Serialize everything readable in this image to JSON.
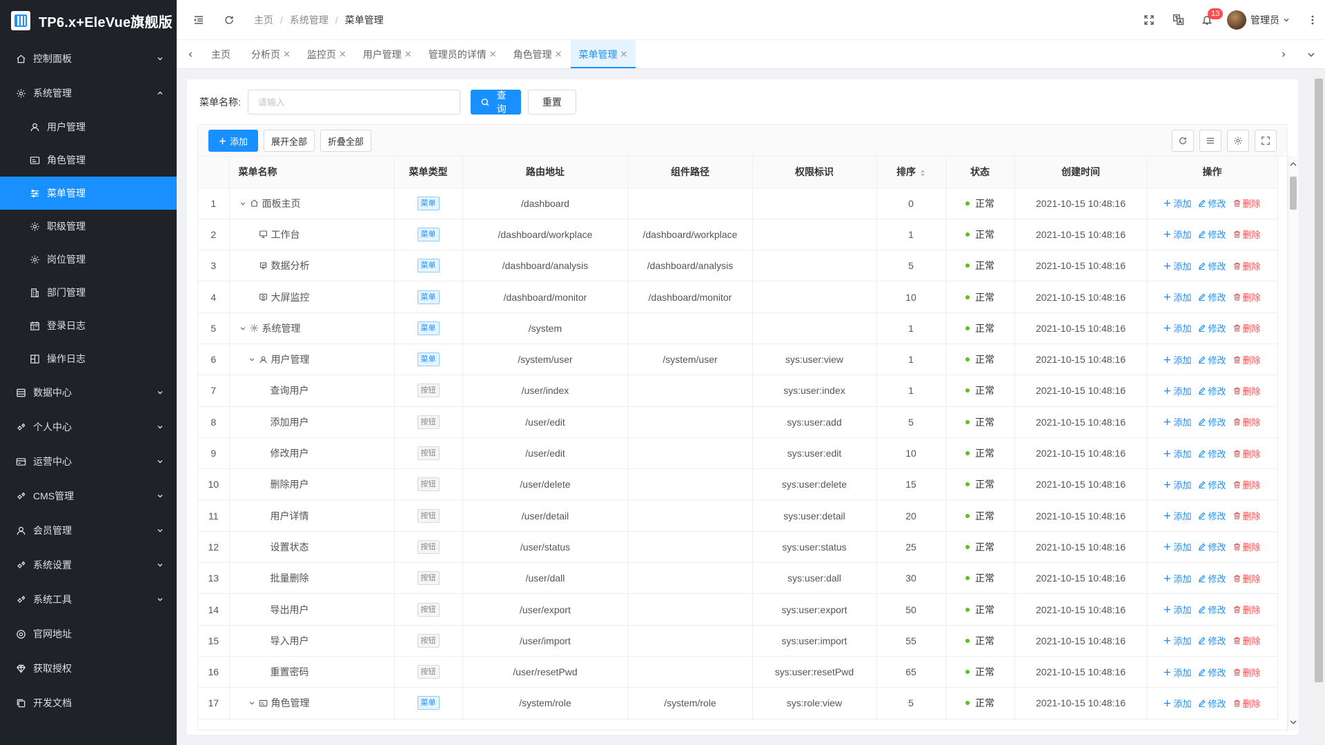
{
  "app": {
    "title": "TP6.x+EleVue旗舰版"
  },
  "sidebar": {
    "items": [
      {
        "label": "控制面板",
        "icon": "home-icon",
        "level": "top",
        "expandable": true,
        "expanded": false,
        "active": false
      },
      {
        "label": "系统管理",
        "icon": "gear-icon",
        "level": "top",
        "expandable": true,
        "expanded": true,
        "active": false
      },
      {
        "label": "用户管理",
        "icon": "user-icon",
        "level": "sub",
        "active": false
      },
      {
        "label": "角色管理",
        "icon": "id-card-icon",
        "level": "sub",
        "active": false
      },
      {
        "label": "菜单管理",
        "icon": "sliders-icon",
        "level": "sub",
        "active": true
      },
      {
        "label": "职级管理",
        "icon": "gear-icon",
        "level": "sub",
        "active": false
      },
      {
        "label": "岗位管理",
        "icon": "gear-icon",
        "level": "sub",
        "active": false
      },
      {
        "label": "部门管理",
        "icon": "building-icon",
        "level": "sub",
        "active": false
      },
      {
        "label": "登录日志",
        "icon": "calendar-icon",
        "level": "sub",
        "active": false
      },
      {
        "label": "操作日志",
        "icon": "log-icon",
        "level": "sub",
        "active": false
      },
      {
        "label": "数据中心",
        "icon": "database-icon",
        "level": "top",
        "expandable": true,
        "active": false
      },
      {
        "label": "个人中心",
        "icon": "gears-icon",
        "level": "top",
        "expandable": true,
        "active": false
      },
      {
        "label": "运营中心",
        "icon": "wallet-icon",
        "level": "top",
        "expandable": true,
        "active": false
      },
      {
        "label": "CMS管理",
        "icon": "gears-icon",
        "level": "top",
        "expandable": true,
        "active": false
      },
      {
        "label": "会员管理",
        "icon": "user-icon",
        "level": "top",
        "expandable": true,
        "active": false
      },
      {
        "label": "系统设置",
        "icon": "gears-icon",
        "level": "top",
        "expandable": true,
        "active": false
      },
      {
        "label": "系统工具",
        "icon": "gears-icon",
        "level": "top",
        "expandable": true,
        "active": false
      },
      {
        "label": "官网地址",
        "icon": "globe-icon",
        "level": "top",
        "expandable": false,
        "active": false
      },
      {
        "label": "获取授权",
        "icon": "diamond-icon",
        "level": "top",
        "expandable": false,
        "active": false
      },
      {
        "label": "开发文档",
        "icon": "copy-icon",
        "level": "top",
        "expandable": false,
        "active": false
      }
    ]
  },
  "header": {
    "breadcrumb": [
      "主页",
      "系统管理",
      "菜单管理"
    ],
    "notification_count": "13",
    "user_name": "管理员"
  },
  "tabs": [
    {
      "label": "主页",
      "closable": false,
      "active": false
    },
    {
      "label": "分析页",
      "closable": true,
      "active": false
    },
    {
      "label": "监控页",
      "closable": true,
      "active": false
    },
    {
      "label": "用户管理",
      "closable": true,
      "active": false
    },
    {
      "label": "管理员的详情",
      "closable": true,
      "active": false
    },
    {
      "label": "角色管理",
      "closable": true,
      "active": false
    },
    {
      "label": "菜单管理",
      "closable": true,
      "active": true
    }
  ],
  "search": {
    "label": "菜单名称:",
    "placeholder": "请输入",
    "value": "",
    "query_label": "查询",
    "reset_label": "重置"
  },
  "toolbar": {
    "add_label": "添加",
    "expand_all_label": "展开全部",
    "collapse_all_label": "折叠全部"
  },
  "table": {
    "columns": [
      "",
      "菜单名称",
      "菜单类型",
      "路由地址",
      "组件路径",
      "权限标识",
      "排序",
      "状态",
      "创建时间",
      "操作"
    ],
    "op_labels": {
      "add": "添加",
      "edit": "修改",
      "delete": "删除"
    },
    "rows": [
      {
        "index": "1",
        "name": "面板主页",
        "depth": 0,
        "arrow": true,
        "icon": "home-icon",
        "type": "菜单",
        "type_kind": "menu",
        "path": "/dashboard",
        "component": "",
        "perm": "",
        "sort": "0",
        "status": "正常",
        "created": "2021-10-15 10:48:16"
      },
      {
        "index": "2",
        "name": "工作台",
        "depth": 1,
        "arrow": false,
        "icon": "monitor-icon",
        "type": "菜单",
        "type_kind": "menu",
        "path": "/dashboard/workplace",
        "component": "/dashboard/workplace",
        "perm": "",
        "sort": "1",
        "status": "正常",
        "created": "2021-10-15 10:48:16"
      },
      {
        "index": "3",
        "name": "数据分析",
        "depth": 1,
        "arrow": false,
        "icon": "chart-icon",
        "type": "菜单",
        "type_kind": "menu",
        "path": "/dashboard/analysis",
        "component": "/dashboard/analysis",
        "perm": "",
        "sort": "5",
        "status": "正常",
        "created": "2021-10-15 10:48:16"
      },
      {
        "index": "4",
        "name": "大屏监控",
        "depth": 1,
        "arrow": false,
        "icon": "screen-icon",
        "type": "菜单",
        "type_kind": "menu",
        "path": "/dashboard/monitor",
        "component": "/dashboard/monitor",
        "perm": "",
        "sort": "10",
        "status": "正常",
        "created": "2021-10-15 10:48:16"
      },
      {
        "index": "5",
        "name": "系统管理",
        "depth": 0,
        "arrow": true,
        "icon": "gear-icon",
        "type": "菜单",
        "type_kind": "menu",
        "path": "/system",
        "component": "",
        "perm": "",
        "sort": "1",
        "status": "正常",
        "created": "2021-10-15 10:48:16"
      },
      {
        "index": "6",
        "name": "用户管理",
        "depth": 1,
        "arrow": true,
        "icon": "user-icon",
        "type": "菜单",
        "type_kind": "menu",
        "path": "/system/user",
        "component": "/system/user",
        "perm": "sys:user:view",
        "sort": "1",
        "status": "正常",
        "created": "2021-10-15 10:48:16"
      },
      {
        "index": "7",
        "name": "查询用户",
        "depth": 2,
        "arrow": false,
        "icon": "",
        "type": "按钮",
        "type_kind": "button",
        "path": "/user/index",
        "component": "",
        "perm": "sys:user:index",
        "sort": "1",
        "status": "正常",
        "created": "2021-10-15 10:48:16"
      },
      {
        "index": "8",
        "name": "添加用户",
        "depth": 2,
        "arrow": false,
        "icon": "",
        "type": "按钮",
        "type_kind": "button",
        "path": "/user/edit",
        "component": "",
        "perm": "sys:user:add",
        "sort": "5",
        "status": "正常",
        "created": "2021-10-15 10:48:16"
      },
      {
        "index": "9",
        "name": "修改用户",
        "depth": 2,
        "arrow": false,
        "icon": "",
        "type": "按钮",
        "type_kind": "button",
        "path": "/user/edit",
        "component": "",
        "perm": "sys:user:edit",
        "sort": "10",
        "status": "正常",
        "created": "2021-10-15 10:48:16"
      },
      {
        "index": "10",
        "name": "删除用户",
        "depth": 2,
        "arrow": false,
        "icon": "",
        "type": "按钮",
        "type_kind": "button",
        "path": "/user/delete",
        "component": "",
        "perm": "sys:user:delete",
        "sort": "15",
        "status": "正常",
        "created": "2021-10-15 10:48:16"
      },
      {
        "index": "11",
        "name": "用户详情",
        "depth": 2,
        "arrow": false,
        "icon": "",
        "type": "按钮",
        "type_kind": "button",
        "path": "/user/detail",
        "component": "",
        "perm": "sys:user:detail",
        "sort": "20",
        "status": "正常",
        "created": "2021-10-15 10:48:16"
      },
      {
        "index": "12",
        "name": "设置状态",
        "depth": 2,
        "arrow": false,
        "icon": "",
        "type": "按钮",
        "type_kind": "button",
        "path": "/user/status",
        "component": "",
        "perm": "sys:user:status",
        "sort": "25",
        "status": "正常",
        "created": "2021-10-15 10:48:16"
      },
      {
        "index": "13",
        "name": "批量删除",
        "depth": 2,
        "arrow": false,
        "icon": "",
        "type": "按钮",
        "type_kind": "button",
        "path": "/user/dall",
        "component": "",
        "perm": "sys:user:dall",
        "sort": "30",
        "status": "正常",
        "created": "2021-10-15 10:48:16"
      },
      {
        "index": "14",
        "name": "导出用户",
        "depth": 2,
        "arrow": false,
        "icon": "",
        "type": "按钮",
        "type_kind": "button",
        "path": "/user/export",
        "component": "",
        "perm": "sys:user:export",
        "sort": "50",
        "status": "正常",
        "created": "2021-10-15 10:48:16"
      },
      {
        "index": "15",
        "name": "导入用户",
        "depth": 2,
        "arrow": false,
        "icon": "",
        "type": "按钮",
        "type_kind": "button",
        "path": "/user/import",
        "component": "",
        "perm": "sys:user:import",
        "sort": "55",
        "status": "正常",
        "created": "2021-10-15 10:48:16"
      },
      {
        "index": "16",
        "name": "重置密码",
        "depth": 2,
        "arrow": false,
        "icon": "",
        "type": "按钮",
        "type_kind": "button",
        "path": "/user/resetPwd",
        "component": "",
        "perm": "sys:user:resetPwd",
        "sort": "65",
        "status": "正常",
        "created": "2021-10-15 10:48:16"
      },
      {
        "index": "17",
        "name": "角色管理",
        "depth": 1,
        "arrow": true,
        "icon": "id-card-icon",
        "type": "菜单",
        "type_kind": "menu",
        "path": "/system/role",
        "component": "/system/role",
        "perm": "sys:role:view",
        "sort": "5",
        "status": "正常",
        "created": "2021-10-15 10:48:16"
      }
    ]
  },
  "colors": {
    "primary": "#1890ff",
    "danger": "#ff4d4f",
    "success": "#52c41a",
    "sidebar_bg": "#20222a"
  }
}
